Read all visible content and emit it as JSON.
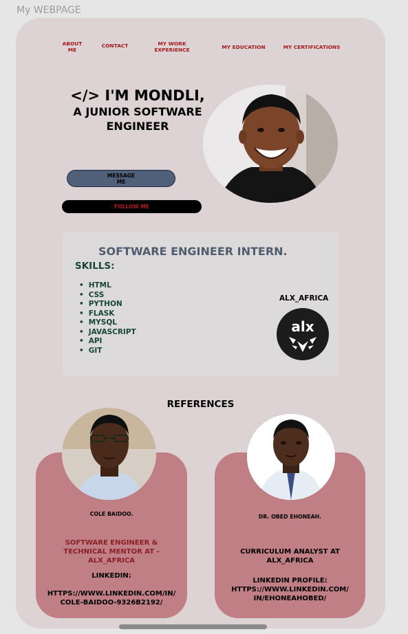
{
  "page": {
    "title": "My WEBPAGE"
  },
  "nav": {
    "about": "ABOUT\nME",
    "contact": "CONTACT",
    "work": "MY WORK\nEXPERIENCE",
    "education": "MY EDUCATION",
    "certifications": "MY CERTIFICATIONS"
  },
  "hero": {
    "line1": "</> I'M MONDLI,",
    "line2": "A JUNIOR SOFTWARE",
    "line3": "ENGINEER",
    "message_button": "MESSAGE\nME",
    "follow_button": "FOLLOW ME"
  },
  "skills": {
    "title": "SOFTWARE ENGINEER INTERN.",
    "heading": "SKILLS:",
    "items": [
      "HTML",
      "CSS",
      "PYTHON",
      "FLASK",
      "MYSQL",
      "JAVASCRIPT",
      "API",
      "GIT"
    ],
    "org_name": "ALX_AFRICA",
    "logo_text": "alx"
  },
  "references": {
    "heading": "REFERENCES",
    "ref1": {
      "name": "COLE BAIDOO.",
      "role": "SOFTWARE ENGINEER &\nTECHNICAL MENTOR AT -\nALX_AFRICA",
      "linkedin_label": "LINKEDIN:",
      "linkedin_url": "HTTPS://WWW.LINKEDIN.COM/IN/\nCOLE-BAIDOO-9326B2192/"
    },
    "ref2": {
      "name": "DR. OBED EHONEAH.",
      "role": "CURRICULUM ANALYST AT\nALX_AFRICA",
      "linkedin_label": "LINKEDIN PROFILE:",
      "linkedin_url": "HTTPS://WWW.LINKEDIN.COM/\nIN/EHONEAHOBED/"
    }
  },
  "colors": {
    "card_bg": "#ddd3d5",
    "nav_text": "#a41a1a",
    "skills_text": "#174537",
    "reference_card": "#c07f84",
    "role_text": "#8a1f27"
  }
}
